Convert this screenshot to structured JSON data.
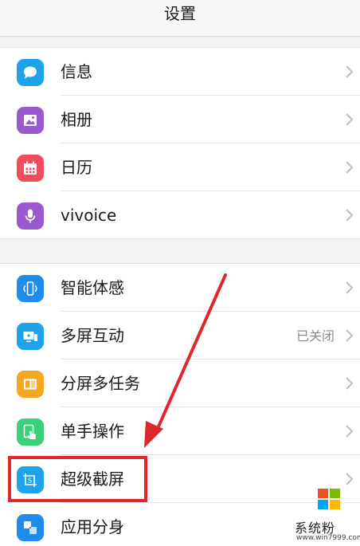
{
  "header": {
    "title": "设置"
  },
  "group1": [
    {
      "label": "信息",
      "icon": "message-icon",
      "color": "#1ca3ea"
    },
    {
      "label": "相册",
      "icon": "gallery-icon",
      "color": "#9b59d0"
    },
    {
      "label": "日历",
      "icon": "calendar-icon",
      "color": "#ef4d5b"
    },
    {
      "label": "vivoice",
      "icon": "microphone-icon",
      "color": "#9b59d0"
    }
  ],
  "group2": [
    {
      "label": "智能体感",
      "icon": "motion-sense-icon",
      "color": "#1f8bea"
    },
    {
      "label": "多屏互动",
      "icon": "multi-screen-icon",
      "color": "#1ca3ea",
      "status": "已关闭"
    },
    {
      "label": "分屏多任务",
      "icon": "split-screen-icon",
      "color": "#f5a623"
    },
    {
      "label": "单手操作",
      "icon": "one-hand-icon",
      "color": "#3ccf7a"
    },
    {
      "label": "超级截屏",
      "icon": "super-screenshot-icon",
      "color": "#1ca3ea"
    },
    {
      "label": "应用分身",
      "icon": "app-clone-icon",
      "color": "#1f8bea"
    }
  ],
  "annotation": {
    "color": "#e0262d"
  },
  "watermark": {
    "text": "系统粉",
    "url": "www.win7999.com"
  }
}
